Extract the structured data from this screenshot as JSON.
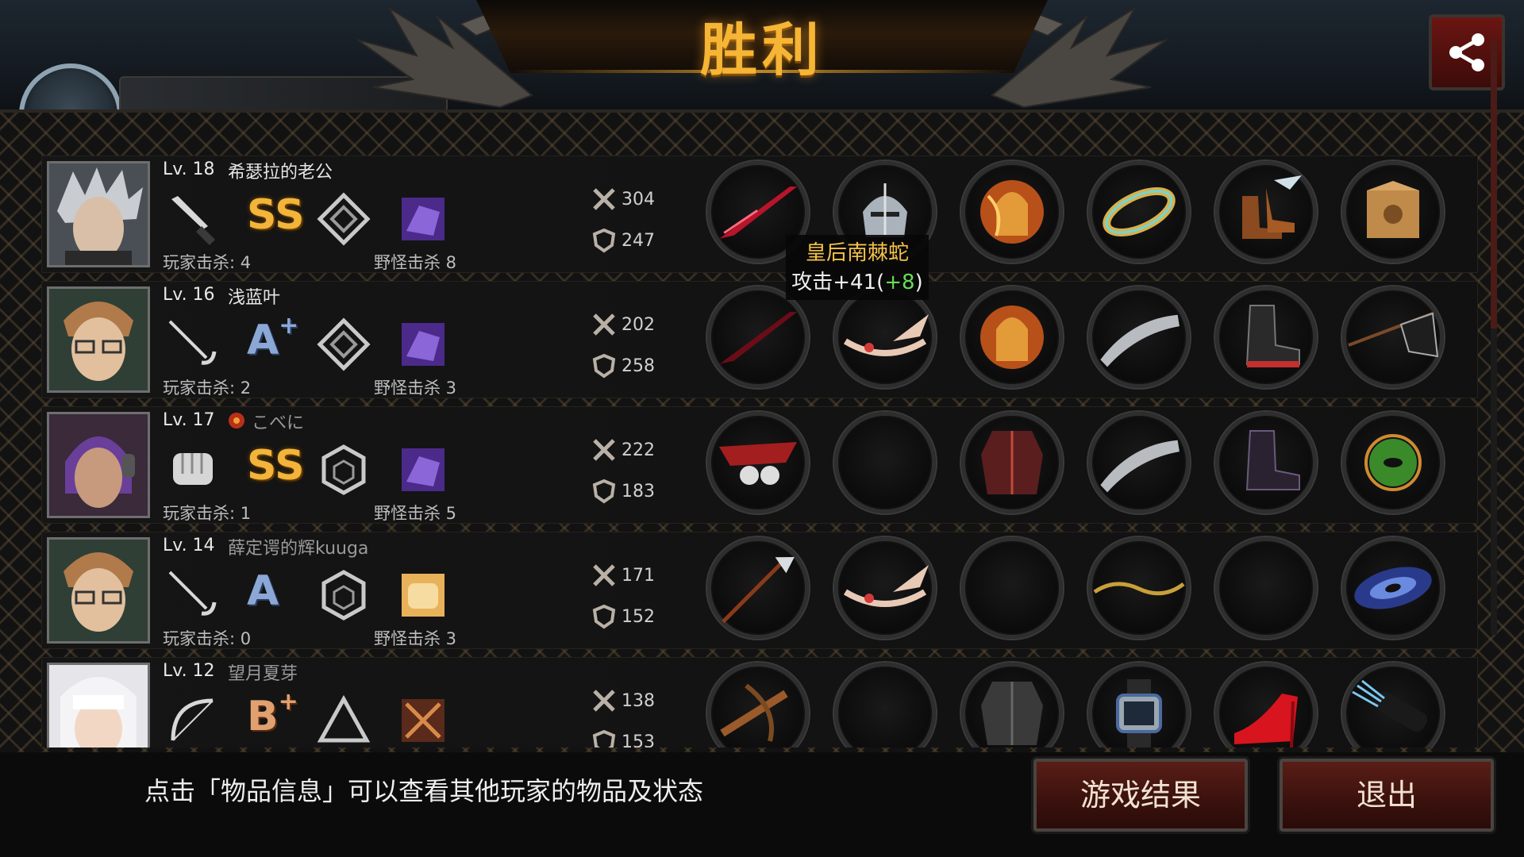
{
  "header": {
    "title": "胜利",
    "share_icon": "share-icon"
  },
  "players": [
    {
      "level": "Lv. 18",
      "name": "希瑟拉的老公",
      "weapon_icon": "knife-icon",
      "grade": "SS",
      "rank_icon": "diamond-rank-icon",
      "skill_icon": "purple-beast-skill-icon",
      "player_kills": "玩家击杀: 4",
      "monster_kills": "野怪击杀 8",
      "attack": "304",
      "defense": "247",
      "items": [
        "red-blade-icon",
        "knight-helmet-icon",
        "flame-armor-icon",
        "jeweled-bracelet-icon",
        "winged-boots-icon",
        "cat-box-icon"
      ]
    },
    {
      "level": "Lv. 16",
      "name": "浅蓝叶",
      "weapon_icon": "rapier-icon",
      "grade": "A",
      "grade_plus": "+",
      "rank_icon": "diamond-rank-icon",
      "skill_icon": "purple-beast-skill-icon",
      "player_kills": "玩家击杀: 2",
      "monster_kills": "野怪击杀 3",
      "attack": "202",
      "defense": "258",
      "items": [
        "red-blade-icon",
        "winged-circlet-icon",
        "flame-armor-icon",
        "spiked-gauntlet-icon",
        "combat-boots-icon",
        "black-flag-icon"
      ]
    },
    {
      "level": "Lv. 17",
      "name": "こべに",
      "weapon_icon": "fist-icon",
      "grade": "SS",
      "rank_icon": "hexagon-rank-icon",
      "skill_icon": "purple-beast-skill-icon",
      "player_kills": "玩家击杀: 1",
      "monster_kills": "野怪击杀 5",
      "attack": "222",
      "defense": "183",
      "items": [
        "skull-knuckle-icon",
        "empty-slot",
        "studded-jacket-icon",
        "spiked-gauntlet-icon",
        "dark-boots-icon",
        "green-orb-icon"
      ]
    },
    {
      "level": "Lv. 14",
      "name": "薛定谔的辉kuuga",
      "weapon_icon": "rapier-icon",
      "grade": "A",
      "rank_icon": "hexagon-rank-icon",
      "skill_icon": "bread-skill-icon",
      "player_kills": "玩家击杀: 0",
      "monster_kills": "野怪击杀 3",
      "attack": "171",
      "defense": "152",
      "items": [
        "spear-icon",
        "winged-circlet-icon",
        "empty-slot",
        "vine-bracelet-icon",
        "empty-slot",
        "galaxy-icon"
      ]
    },
    {
      "level": "Lv. 12",
      "name": "望月夏芽",
      "weapon_icon": "bow-icon",
      "grade": "B",
      "grade_plus": "+",
      "rank_icon": "triangle-rank-icon",
      "skill_icon": "crossed-weapons-skill-icon",
      "player_kills": "",
      "monster_kills": "",
      "attack": "138",
      "defense": "153",
      "items": [
        "crossbow-icon",
        "empty-slot",
        "leather-jacket-icon",
        "wristwatch-icon",
        "red-heels-icon",
        "quiver-icon"
      ]
    }
  ],
  "tooltip": {
    "item_name": "皇后南棘蛇",
    "stat": "攻击+41(",
    "bonus": "+8",
    "close": ")"
  },
  "footer": {
    "hint": "点击「物品信息」可以查看其他玩家的物品及状态",
    "results_button": "游戏结果",
    "exit_button": "退出"
  },
  "colors": {
    "title": "#f6b534",
    "button": "#5a1d17",
    "bonus_green": "#66dd55",
    "tooltip_name": "#f4c24a"
  }
}
